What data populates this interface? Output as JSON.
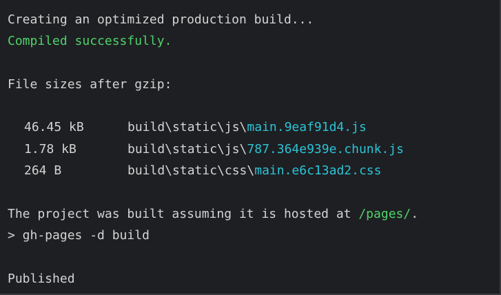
{
  "terminal": {
    "line1": "Creating an optimized production build...",
    "line2": "Compiled successfully.",
    "line3": "File sizes after gzip:",
    "files": [
      {
        "size": "46.45 kB",
        "path": "build\\static\\js\\",
        "file": "main.9eaf91d4.js"
      },
      {
        "size": "1.78 kB",
        "path": "build\\static\\js\\",
        "file": "787.364e939e.chunk.js"
      },
      {
        "size": "264 B",
        "path": "build\\static\\css\\",
        "file": "main.e6c13ad2.css"
      }
    ],
    "hosted_prefix": "The project was built assuming it is hosted at ",
    "hosted_path": "/pages/",
    "hosted_suffix": ".",
    "command": "> gh-pages -d build",
    "published": "Published"
  },
  "colors": {
    "background": "#1e1f22",
    "text": "#d4d4d4",
    "success": "#4ed36b",
    "filename": "#2bc4d8"
  }
}
